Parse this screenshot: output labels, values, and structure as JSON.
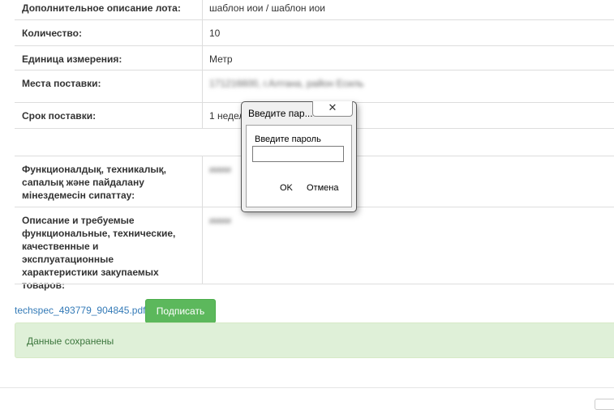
{
  "rows": [
    {
      "label": "Дополнительное описание лота:",
      "value": "шаблон иои / шаблон иои"
    },
    {
      "label": "Количество:",
      "value": "10"
    },
    {
      "label": "Единица измерения:",
      "value": "Метр"
    },
    {
      "label": "Места поставки:",
      "value": "171216600, г.Алтана, район Есиль"
    },
    {
      "label": "Срок поставки:",
      "value": "1 недел"
    }
  ],
  "spec_rows": [
    {
      "label": "Функционалдық, техникалық, сапалық және пайдалану мінездемесін сипаттау:",
      "value": "ииии"
    },
    {
      "label": "Описание и требуемые функциональные, технические, качественные и эксплуатационные характеристики закупаемых товаров:",
      "value": "ииии"
    }
  ],
  "pdf_link": "techspec_493779_904845.pdf",
  "sign_button": "Подписать",
  "alert": "Данные сохранены",
  "dialog": {
    "title": "Введите пар...",
    "close": "✕",
    "prompt": "Введите пароль",
    "input_value": "",
    "ok": "OK",
    "cancel": "Отмена"
  },
  "colors": {
    "success": "#5cb85c",
    "alert_bg": "#dff0d8",
    "link": "#337ab7"
  }
}
